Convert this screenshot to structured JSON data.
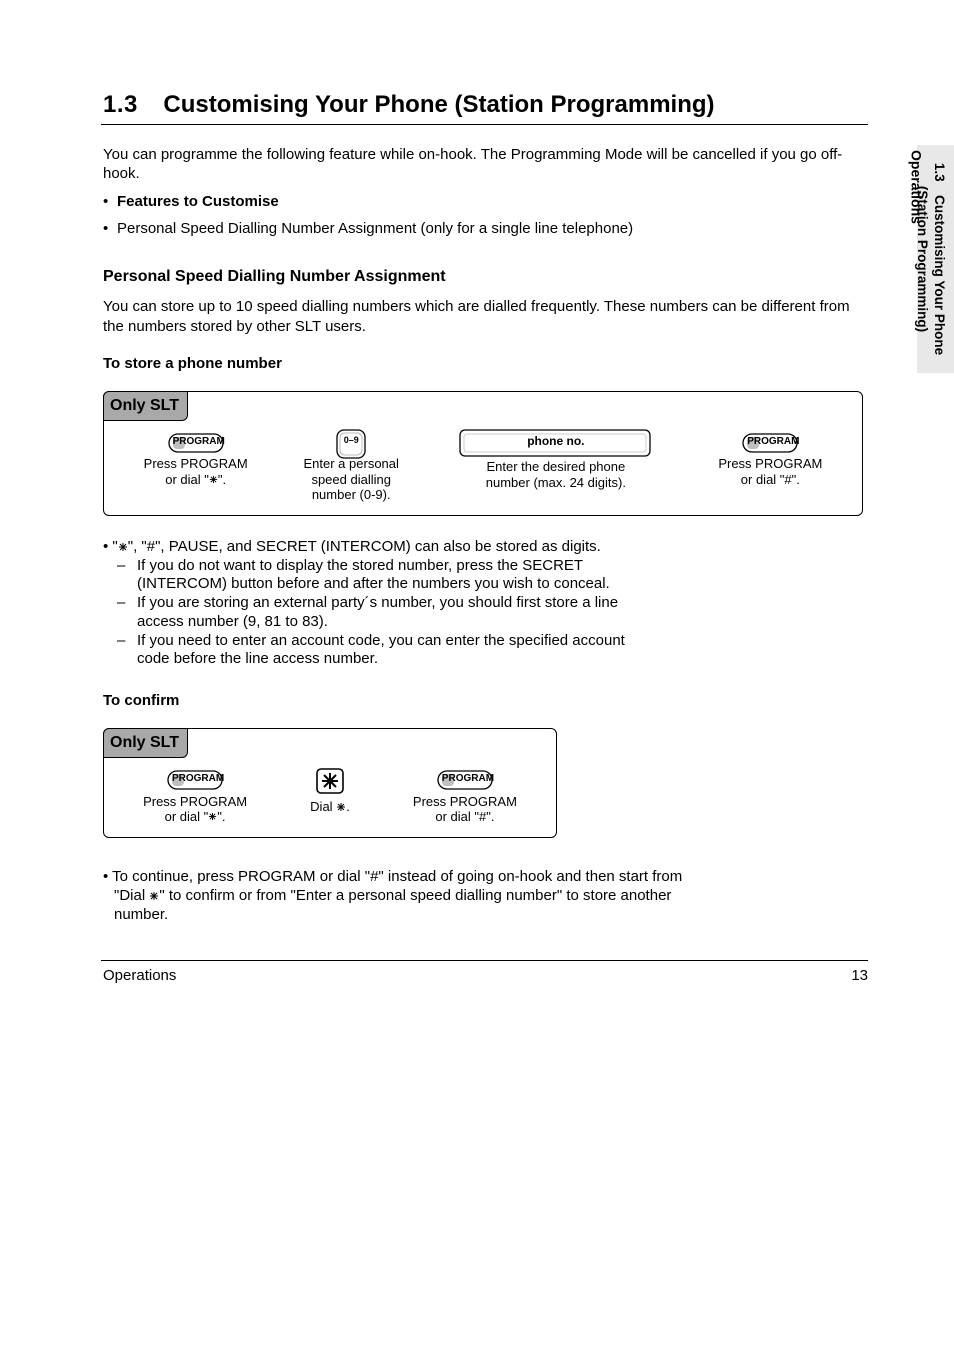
{
  "header": {
    "section_number": "1.3",
    "section_title": "Customising Your Phone (Station Programming)"
  },
  "side_tab": {
    "heading": "Operations",
    "label": "1.3 Customising Your Phone\n(Station Programming)"
  },
  "intro": "You can programme the following feature while on-hook. The Programming Mode will be cancelled if you go off-hook.",
  "bullets": {
    "title": "Features to Customise",
    "item1": "Personal Speed Dialling Number Assignment (only for a single line telephone)"
  },
  "speed_dial": {
    "title": "Personal Speed Dialling Number Assignment",
    "p1": "You can store up to 10 speed dialling numbers which are dialled frequently. These numbers can be different from the numbers stored by other SLT users.",
    "p2": "To store a phone number",
    "proc_tab": "Only SLT",
    "steps": {
      "program": "PROGRAM",
      "program_cap": "Press PROGRAM\nor dial \"   \".",
      "dial_no": "0–9",
      "dial_no_cap": "Enter a personal\nspeed dialling\nnumber (0-9).",
      "phone_field": "phone no.",
      "phone_field_cap": "Enter the desired phone\nnumber (max. 24 digits).",
      "program2": "PROGRAM",
      "program2_cap": "Press PROGRAM\nor dial \"#\"."
    }
  },
  "cond": {
    "bullet1_lead": "•",
    "bullet1_text": "\"    \", \"#\", PAUSE, and SECRET (INTERCOM) can also be stored as digits.",
    "sub_a_lead": "–",
    "sub_a_text": "If you do not want to display the stored number, press the SECRET",
    "sub_a_text2": "(INTERCOM) button before and after the numbers you wish to conceal.",
    "sub_b_lead": "–",
    "sub_b_text": "If you are storing an external party´s number, you should first store a line",
    "sub_b_text2": "access number (9, 81 to 83).",
    "sub_c_lead": "–",
    "sub_c_text": "If you need to enter an account code, you can enter the specified account",
    "sub_c_text2": "code before the line access number."
  },
  "confirm": {
    "proc_tab": "Only SLT",
    "title": "To confirm",
    "steps": {
      "program": "PROGRAM",
      "program_cap": "Press PROGRAM\nor dial \"   \".",
      "star_cap": "Dial    .",
      "program2": "PROGRAM",
      "program2_cap": "Press PROGRAM\nor dial \"#\"."
    }
  },
  "tail": {
    "line1": "• To continue, press PROGRAM or dial \"#\" instead of going on-hook and then start from",
    "line2": "\"Dial    \" to confirm or from \"Enter a personal speed dialling number\" to store another",
    "line3": "number."
  },
  "footer": {
    "left": "Operations",
    "right": "13"
  }
}
